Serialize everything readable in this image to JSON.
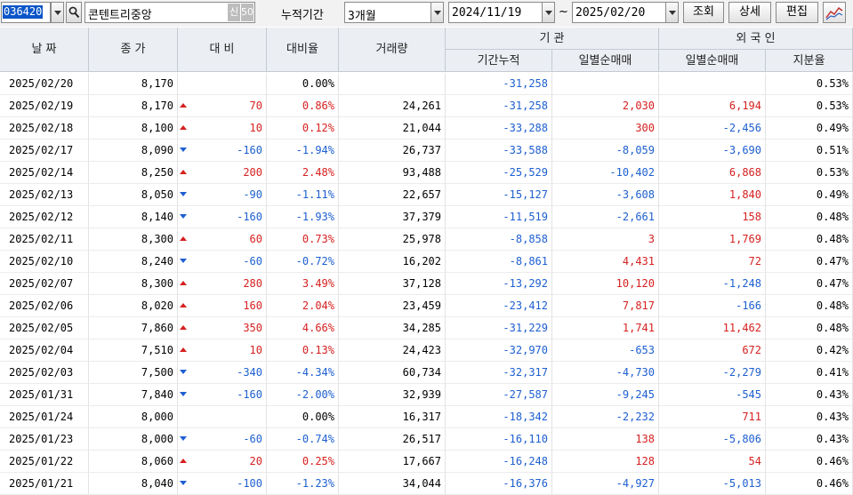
{
  "toolbar": {
    "stock_code": "036420",
    "stock_name": "콘텐트리중앙",
    "tag_credit": "신",
    "tag_margin": "50",
    "period_label": "누적기간",
    "period_value": "3개월",
    "start_date": "2024/11/19",
    "range_sep": "~",
    "end_date": "2025/02/20",
    "query_button": "조회",
    "detail_button": "상세",
    "edit_button": "편집"
  },
  "headers": {
    "date": "날  짜",
    "close": "종  가",
    "change": "대  비",
    "change_rate": "대비율",
    "volume": "거래량",
    "institution": "기    관",
    "inst_cumulative": "기간누적",
    "inst_daily_net": "일별순매매",
    "foreign": "외 국 인",
    "foreign_daily_net": "일별순매매",
    "foreign_ownership": "지분율"
  },
  "colors": {
    "up": "#d62020",
    "down": "#1d5fd0"
  },
  "rows": [
    [
      "2025/02/20",
      "8,170",
      "",
      "",
      "0.00%",
      "",
      "-31,258",
      "",
      "",
      "0.53%"
    ],
    [
      "2025/02/19",
      "8,170",
      "up",
      "70",
      "0.86%",
      "24,261",
      "-31,258",
      "2,030",
      "6,194",
      "0.53%"
    ],
    [
      "2025/02/18",
      "8,100",
      "up",
      "10",
      "0.12%",
      "21,044",
      "-33,288",
      "300",
      "-2,456",
      "0.49%"
    ],
    [
      "2025/02/17",
      "8,090",
      "down",
      "-160",
      "-1.94%",
      "26,737",
      "-33,588",
      "-8,059",
      "-3,690",
      "0.51%"
    ],
    [
      "2025/02/14",
      "8,250",
      "up",
      "200",
      "2.48%",
      "93,488",
      "-25,529",
      "-10,402",
      "6,868",
      "0.53%"
    ],
    [
      "2025/02/13",
      "8,050",
      "down",
      "-90",
      "-1.11%",
      "22,657",
      "-15,127",
      "-3,608",
      "1,840",
      "0.49%"
    ],
    [
      "2025/02/12",
      "8,140",
      "down",
      "-160",
      "-1.93%",
      "37,379",
      "-11,519",
      "-2,661",
      "158",
      "0.48%"
    ],
    [
      "2025/02/11",
      "8,300",
      "up",
      "60",
      "0.73%",
      "25,978",
      "-8,858",
      "3",
      "1,769",
      "0.48%"
    ],
    [
      "2025/02/10",
      "8,240",
      "down",
      "-60",
      "-0.72%",
      "16,202",
      "-8,861",
      "4,431",
      "72",
      "0.47%"
    ],
    [
      "2025/02/07",
      "8,300",
      "up",
      "280",
      "3.49%",
      "37,128",
      "-13,292",
      "10,120",
      "-1,248",
      "0.47%"
    ],
    [
      "2025/02/06",
      "8,020",
      "up",
      "160",
      "2.04%",
      "23,459",
      "-23,412",
      "7,817",
      "-166",
      "0.48%"
    ],
    [
      "2025/02/05",
      "7,860",
      "up",
      "350",
      "4.66%",
      "34,285",
      "-31,229",
      "1,741",
      "11,462",
      "0.48%"
    ],
    [
      "2025/02/04",
      "7,510",
      "up",
      "10",
      "0.13%",
      "24,423",
      "-32,970",
      "-653",
      "672",
      "0.42%"
    ],
    [
      "2025/02/03",
      "7,500",
      "down",
      "-340",
      "-4.34%",
      "60,734",
      "-32,317",
      "-4,730",
      "-2,279",
      "0.41%"
    ],
    [
      "2025/01/31",
      "7,840",
      "down",
      "-160",
      "-2.00%",
      "32,939",
      "-27,587",
      "-9,245",
      "-545",
      "0.43%"
    ],
    [
      "2025/01/24",
      "8,000",
      "",
      "",
      "0.00%",
      "16,317",
      "-18,342",
      "-2,232",
      "711",
      "0.43%"
    ],
    [
      "2025/01/23",
      "8,000",
      "down",
      "-60",
      "-0.74%",
      "26,517",
      "-16,110",
      "138",
      "-5,806",
      "0.43%"
    ],
    [
      "2025/01/22",
      "8,060",
      "up",
      "20",
      "0.25%",
      "17,667",
      "-16,248",
      "128",
      "54",
      "0.46%"
    ],
    [
      "2025/01/21",
      "8,040",
      "down",
      "-100",
      "-1.23%",
      "34,044",
      "-16,376",
      "-4,927",
      "-5,013",
      "0.46%"
    ]
  ]
}
